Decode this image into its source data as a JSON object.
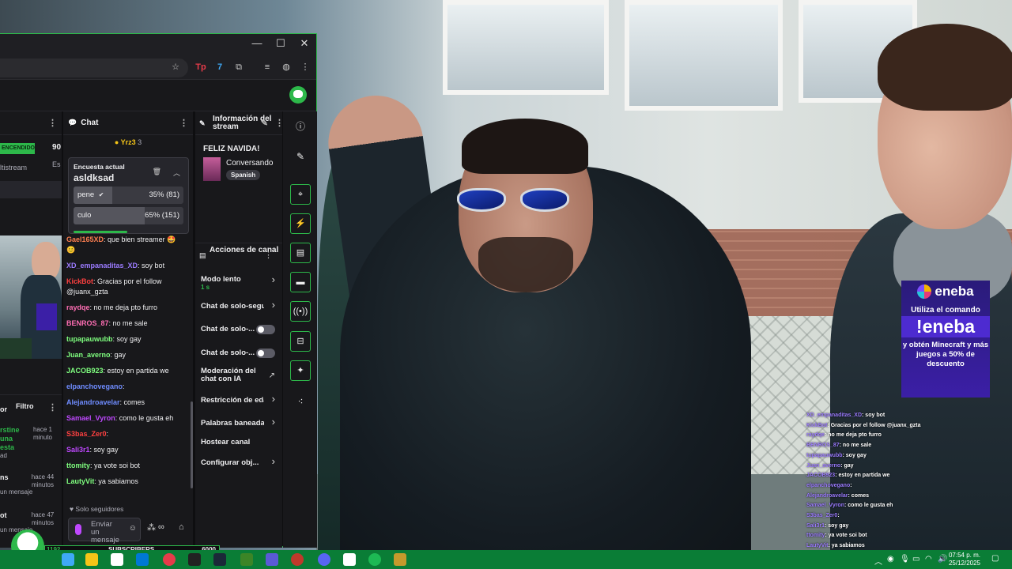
{
  "browser": {
    "controls": {
      "minimize": "—",
      "maximize": "☐",
      "close": "✕"
    }
  },
  "left": {
    "live_badge": "ENCENDIDO",
    "viewers": "90",
    "multistream": "ltistream",
    "estado": "Es",
    "activity_header": "or",
    "filter_label": "Filtro",
    "items": [
      {
        "who": "rstine\nuna\nesta",
        "ago": "hace 1\nminuto",
        "desc": "ad"
      },
      {
        "who": "ns",
        "ago": "hace 44\nminutos",
        "desc": "un mensaje"
      },
      {
        "who": "ot",
        "ago": "hace 47\nminutos",
        "desc": "un mensaje"
      }
    ]
  },
  "chat": {
    "title": "Chat",
    "pinned_user": "Yrz3",
    "pinned_count": "3",
    "poll": {
      "label": "Encuesta actual",
      "question": "asldksad",
      "options": [
        {
          "label": "pene",
          "result": "35% (81)",
          "percent": 35
        },
        {
          "label": "culo",
          "result": "65% (151)",
          "percent": 65
        }
      ],
      "time_left_fraction": 0.48
    },
    "messages": [
      {
        "user": "Gael165XD",
        "color": "#ff7f50",
        "text": ": que bien streamer 🤩 😊"
      },
      {
        "user": "XD_empanaditas_XD",
        "color": "#9b7bff",
        "text": ": soy bot"
      },
      {
        "user": "KickBot",
        "color": "#ff4040",
        "text": ": Gracias por el follow @juanx_gzta"
      },
      {
        "user": "raydqe",
        "color": "#ff6eb4",
        "text": ": no me deja pto furro"
      },
      {
        "user": "BENROS_87",
        "color": "#ff6eb4",
        "text": ": no me sale"
      },
      {
        "user": "tupapauwubb",
        "color": "#7fff7f",
        "text": ": soy gay"
      },
      {
        "user": "Juan_averno",
        "color": "#7fff7f",
        "text": ": gay"
      },
      {
        "user": "JACOB923",
        "color": "#7fff7f",
        "text": ": estoy en partida we"
      },
      {
        "user": "elpanchovegano",
        "color": "#6f8cff",
        "text": ":"
      },
      {
        "user": "Alejandroavelar",
        "color": "#6f8cff",
        "text": ": comes"
      },
      {
        "user": "Samael_Vyron",
        "color": "#bf48ff",
        "text": ": como le gusta eh"
      },
      {
        "user": "S3bas_Zer0",
        "color": "#ff4040",
        "text": ":"
      },
      {
        "user": "Sali3r1",
        "color": "#bf48ff",
        "text": ": soy gay"
      },
      {
        "user": "ttomity",
        "color": "#7fff7f",
        "text": ": ya vote soi bot"
      },
      {
        "user": "LautyVit",
        "color": "#7fff7f",
        "text": ": ya sabiamos"
      }
    ],
    "mode": "Solo seguidores",
    "input_placeholder": "Enviar un mensaje"
  },
  "info": {
    "title": "Información del stream",
    "stream_title": "FELIZ NAVIDA!",
    "category": "Conversando",
    "tag": "Spanish"
  },
  "actions": {
    "title": "Acciones de canal",
    "items": [
      {
        "label": "Modo lento",
        "sub": "1 s",
        "control": "chevron"
      },
      {
        "label": "Chat de solo-segu",
        "control": "chevron"
      },
      {
        "label": "Chat de solo-...",
        "control": "toggle"
      },
      {
        "label": "Chat de solo-...",
        "control": "toggle"
      },
      {
        "label": "Moderación del chat con IA",
        "control": "external"
      },
      {
        "label": "Restricción de eda",
        "control": "chevron"
      },
      {
        "label": "Palabras baneada",
        "control": "chevron"
      },
      {
        "label": "Hostear canal",
        "control": "none"
      },
      {
        "label": "Configurar obj...",
        "control": "chevron"
      }
    ]
  },
  "overlay": {
    "eneba_brand": "eneba",
    "eneba_line1": "Utiliza el comando",
    "eneba_command": "!eneba",
    "eneba_line2": "y obtén Minecraft y más juegos a 50% de descuento",
    "subs_left": "1192",
    "subs_label": "SUBSCRIBERS",
    "subs_goal": "6000",
    "chat": [
      {
        "user": "XD_empanaditas_XD",
        "text": ": soy bot"
      },
      {
        "user": "KickBot",
        "text": ": Gracias por el follow @juanx_gzta"
      },
      {
        "user": "raydqe",
        "text": ": no me deja pto furro"
      },
      {
        "user": "BENROS_87",
        "text": ": no me sale"
      },
      {
        "user": "tupapauwubb",
        "text": ": soy gay"
      },
      {
        "user": "Juan_averno",
        "text": ": gay"
      },
      {
        "user": "JACOB923",
        "text": ": estoy en partida we"
      },
      {
        "user": "elpanchovegano",
        "text": ":"
      },
      {
        "user": "Alejandroavelar",
        "text": ": comes"
      },
      {
        "user": "Samael_Vyron",
        "text": ": como le gusta eh"
      },
      {
        "user": "S3bas_Zer0",
        "text": ":"
      },
      {
        "user": "Sali3r1",
        "text": ": soy gay"
      },
      {
        "user": "ttomity",
        "text": ": ya vote soi bot"
      },
      {
        "user": "LautyVit",
        "text": ": ya sabiamos"
      }
    ]
  },
  "taskbar": {
    "time": "07:54 p. m.",
    "date": "25/12/2025",
    "colors": {
      "bar": "#0a7d36",
      "accent": "#2db84a"
    }
  }
}
